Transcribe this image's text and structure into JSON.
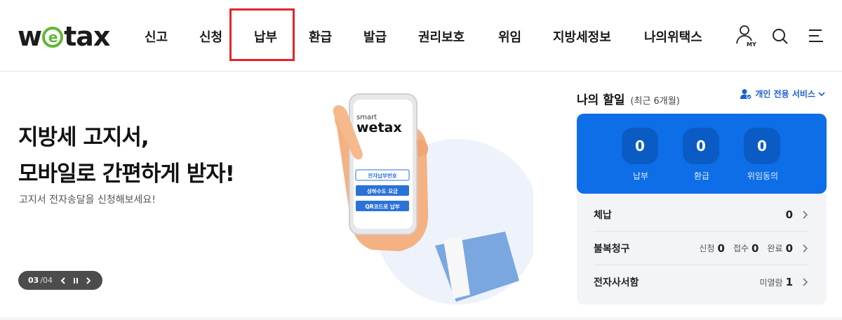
{
  "header": {
    "logo_parts": [
      "w",
      "e",
      "tax"
    ],
    "nav": [
      {
        "label": "신고",
        "name": "nav-item-report"
      },
      {
        "label": "신청",
        "name": "nav-item-apply"
      },
      {
        "label": "납부",
        "name": "nav-item-payment"
      },
      {
        "label": "환급",
        "name": "nav-item-refund"
      },
      {
        "label": "발급",
        "name": "nav-item-issue"
      },
      {
        "label": "권리보호",
        "name": "nav-item-rights"
      },
      {
        "label": "위임",
        "name": "nav-item-delegation"
      },
      {
        "label": "지방세정보",
        "name": "nav-item-local-tax-info"
      },
      {
        "label": "나의위택스",
        "name": "nav-item-my-wetax"
      }
    ],
    "my_badge": "MY",
    "icons": [
      "user-my-icon",
      "search-icon",
      "menu-icon"
    ]
  },
  "hero": {
    "title_line1": "지방세 고지서,",
    "title_line2": "모바일로 간편하게 받자!",
    "subtitle": "고지서 전자송달을 신청해보세요!",
    "pager": {
      "current": "03",
      "separator": "/",
      "total": "04"
    },
    "phone": {
      "smart": "smart",
      "logo": "wetax",
      "buttons": [
        "전자납부번호",
        "상하수도 요금",
        "QR코드로 납부"
      ]
    }
  },
  "todo": {
    "title": "나의 할일",
    "period": "(최근 6개월)",
    "personal_service": "개인 전용 서비스",
    "stats": [
      {
        "value": "0",
        "label": "납부"
      },
      {
        "value": "0",
        "label": "환급"
      },
      {
        "value": "0",
        "label": "위임동의"
      }
    ],
    "rows": [
      {
        "name": "체납",
        "items": [
          {
            "label": "",
            "value": "0"
          }
        ]
      },
      {
        "name": "불복청구",
        "items": [
          {
            "label": "신청",
            "value": "0"
          },
          {
            "label": "접수",
            "value": "0"
          },
          {
            "label": "완료",
            "value": "0"
          }
        ]
      },
      {
        "name": "전자사서함",
        "items": [
          {
            "label": "미열람",
            "value": "1"
          }
        ]
      }
    ]
  },
  "colors": {
    "accent_blue": "#0d6ee8",
    "logo_green": "#5fb832",
    "highlight_red": "#e0262c"
  }
}
